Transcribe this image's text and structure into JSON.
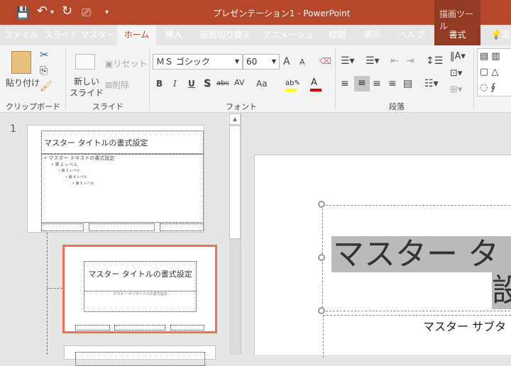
{
  "window": {
    "title": "プレゼンテーション1  -  PowerPoint",
    "context_group": "描画ツール"
  },
  "qat": {
    "save": "💾",
    "undo": "↶",
    "undo_more": "▾",
    "redo": "↻",
    "present": "⎚",
    "customize": "▾"
  },
  "tabs": [
    {
      "label": "ファイル"
    },
    {
      "label": "スライド マスター"
    },
    {
      "label": "ホーム"
    },
    {
      "label": "挿入"
    },
    {
      "label": "画面切り替え"
    },
    {
      "label": "アニメーション"
    },
    {
      "label": "校閲"
    },
    {
      "label": "表示"
    },
    {
      "label": "ヘルプ"
    },
    {
      "label": "書式"
    },
    {
      "label": "実"
    }
  ],
  "ribbon": {
    "clipboard": {
      "paste": "貼り付け",
      "label": "クリップボード"
    },
    "slides": {
      "new_slide_1": "新しい",
      "new_slide_2": "スライド",
      "reset": "リセット",
      "delete": "削除",
      "label": "スライド"
    },
    "font": {
      "name": "ＭＳ ゴシック",
      "size": "60",
      "bold": "B",
      "italic": "I",
      "underline": "U",
      "shadow": "S",
      "strike": "abc",
      "spacing": "AV",
      "case": "Aa",
      "grow": "A",
      "shrink": "A",
      "label": "フォント",
      "highlight_color": "#ffff00",
      "font_color": "#e00000"
    },
    "paragraph": {
      "label": "段落"
    }
  },
  "thumbnails": {
    "number": "1",
    "master": {
      "title": "マスター タイトルの書式設定",
      "levels": [
        "• マスター テキストの書式設定",
        "• 第 2 レベル",
        "• 第 3 レベル",
        "• 第 4 レベル",
        "• 第 5 レベル"
      ]
    },
    "layout": {
      "title": "マスター タイトルの書式設定",
      "subtitle": "マスター サブタイトルの書式設定"
    }
  },
  "slide": {
    "title_line1": "マスター タ",
    "title_line2": "設",
    "subtitle": "マスター サブタ"
  },
  "colors": {
    "accent": "#b7472a",
    "selection": "#f07050"
  }
}
